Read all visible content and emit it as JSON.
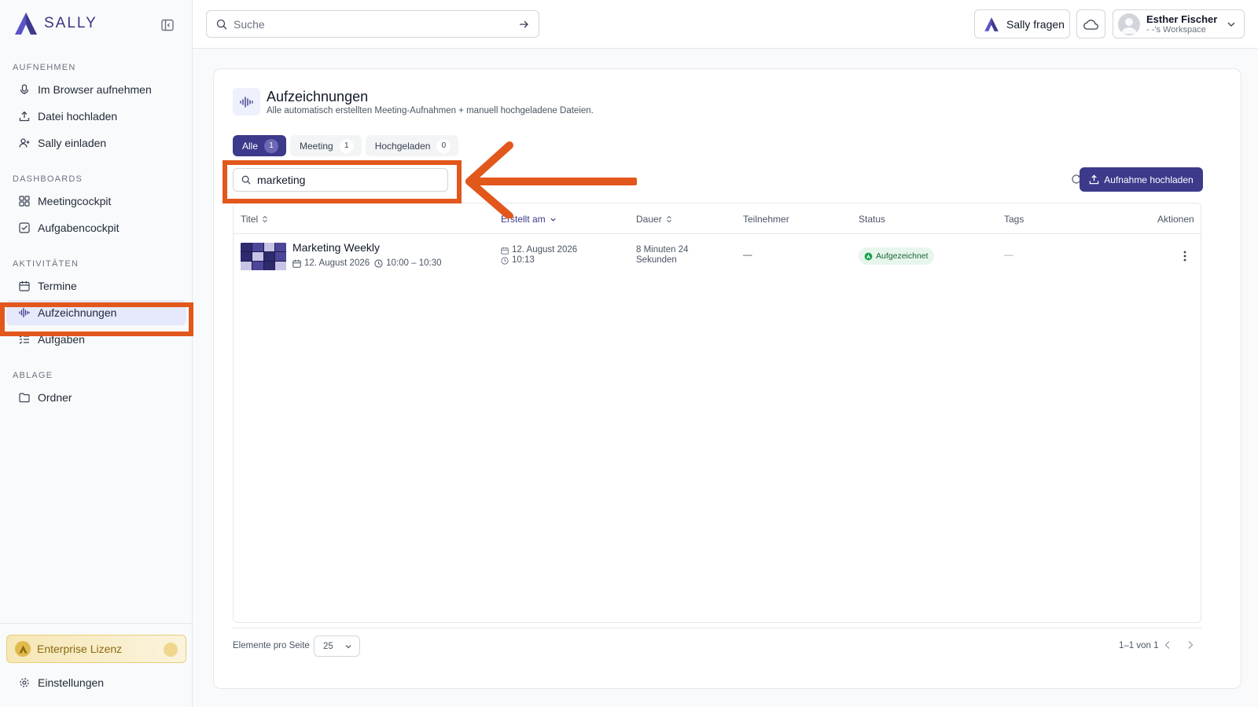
{
  "brand": {
    "name": "SALLY",
    "accent": "#3d3a8c",
    "logo_color": "#5b54c8"
  },
  "sidebar": {
    "sections": [
      {
        "title": "AUFNEHMEN",
        "items": [
          {
            "label": "Im Browser aufnehmen",
            "icon": "microphone-icon"
          },
          {
            "label": "Datei hochladen",
            "icon": "upload-icon"
          },
          {
            "label": "Sally einladen",
            "icon": "user-plus-icon"
          }
        ]
      },
      {
        "title": "DASHBOARDS",
        "items": [
          {
            "label": "Meetingcockpit",
            "icon": "grid-icon"
          },
          {
            "label": "Aufgabencockpit",
            "icon": "checkbox-icon"
          }
        ]
      },
      {
        "title": "AKTIVITÄTEN",
        "items": [
          {
            "label": "Termine",
            "icon": "calendar-icon"
          },
          {
            "label": "Aufzeichnungen",
            "icon": "waveform-icon",
            "active": true
          },
          {
            "label": "Aufgaben",
            "icon": "list-check-icon"
          }
        ]
      },
      {
        "title": "ABLAGE",
        "items": [
          {
            "label": "Ordner",
            "icon": "folder-icon"
          }
        ]
      }
    ],
    "license": "Enterprise Lizenz",
    "settings": "Einstellungen"
  },
  "topbar": {
    "search_placeholder": "Suche",
    "ask_label": "Sally fragen",
    "user_name": "Esther Fischer",
    "user_workspace": "- -'s Workspace"
  },
  "page": {
    "title": "Aufzeichnungen",
    "subtitle": "Alle automatisch erstellten Meeting-Aufnahmen + manuell hochgeladene Dateien.",
    "tabs": [
      {
        "label": "Alle",
        "count": "1",
        "active": true
      },
      {
        "label": "Meeting",
        "count": "1"
      },
      {
        "label": "Hochgeladen",
        "count": "0"
      }
    ],
    "filter_value": "marketing",
    "upload_label": "Aufnahme hochladen"
  },
  "table": {
    "headers": {
      "title": "Titel",
      "created": "Erstellt am",
      "duration": "Dauer",
      "participants": "Teilnehmer",
      "status": "Status",
      "tags": "Tags",
      "actions": "Aktionen"
    },
    "rows": [
      {
        "title": "Marketing Weekly",
        "date": "12. August 2026",
        "time_range": "10:00 – 10:30",
        "created_date": "12. August 2026",
        "created_time": "10:13",
        "duration_line1": "8 Minuten 24",
        "duration_line2": "Sekunden",
        "participants": "—",
        "status": "Aufgezeichnet",
        "tags": "—"
      }
    ]
  },
  "pagination": {
    "per_page_label": "Elemente pro Seite",
    "per_page_value": "25",
    "range": "1–1 von 1"
  },
  "annotation_color": "#e2571b"
}
